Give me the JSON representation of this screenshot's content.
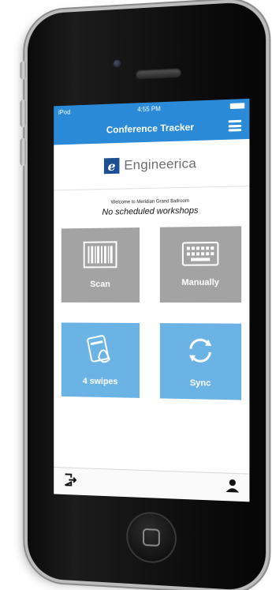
{
  "status_bar": {
    "carrier": "iPod",
    "time": "4:55 PM"
  },
  "nav": {
    "title": "Conference Tracker",
    "menu_icon": "hamburger-menu-icon"
  },
  "logo": {
    "mark": "e",
    "name": "Engineerica",
    "brand_color": "#1d4f91"
  },
  "main": {
    "welcome": "Welcome to Meridian Grand Ballroom",
    "status": "No scheduled workshops"
  },
  "tiles": [
    {
      "label": "Scan",
      "icon": "barcode-icon",
      "color": "#a3a3a3"
    },
    {
      "label": "Manually",
      "icon": "keyboard-icon",
      "color": "#a3a3a3"
    },
    {
      "label": "4 swipes",
      "icon": "swipe-card-icon",
      "color": "#6cb3e5"
    },
    {
      "label": "Sync",
      "icon": "sync-icon",
      "color": "#6cb3e5"
    }
  ],
  "bottom_bar": {
    "left_icon": "logout-icon",
    "right_icon": "user-icon"
  },
  "colors": {
    "accent": "#2a8ad8"
  }
}
